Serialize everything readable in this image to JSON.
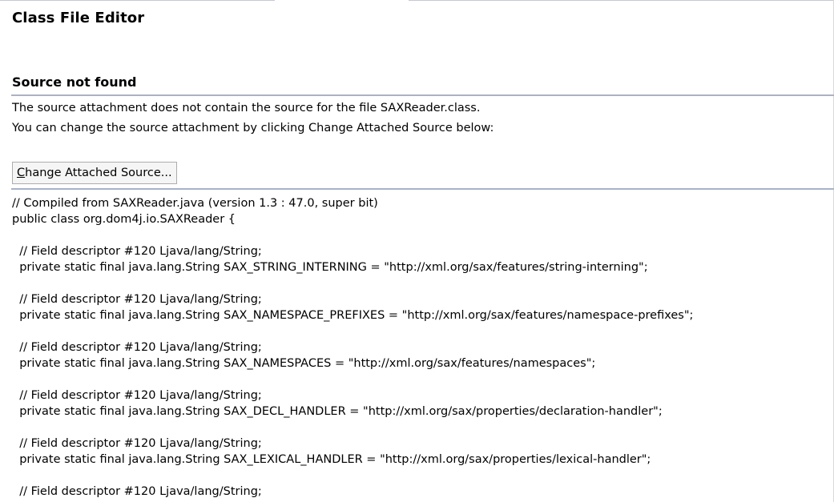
{
  "editor": {
    "title": "Class File Editor"
  },
  "source_not_found": {
    "heading": "Source not found",
    "message1": "The source attachment does not contain the source for the file SAXReader.class.",
    "message2": "You can change the source attachment by clicking Change Attached Source below:",
    "button": {
      "mnemonic": "C",
      "rest": "hange Attached Source..."
    }
  },
  "code_lines": [
    "// Compiled from SAXReader.java (version 1.3 : 47.0, super bit)",
    "public class org.dom4j.io.SAXReader {",
    "",
    "  // Field descriptor #120 Ljava/lang/String;",
    "  private static final java.lang.String SAX_STRING_INTERNING = \"http://xml.org/sax/features/string-interning\";",
    "",
    "  // Field descriptor #120 Ljava/lang/String;",
    "  private static final java.lang.String SAX_NAMESPACE_PREFIXES = \"http://xml.org/sax/features/namespace-prefixes\";",
    "",
    "  // Field descriptor #120 Ljava/lang/String;",
    "  private static final java.lang.String SAX_NAMESPACES = \"http://xml.org/sax/features/namespaces\";",
    "",
    "  // Field descriptor #120 Ljava/lang/String;",
    "  private static final java.lang.String SAX_DECL_HANDLER = \"http://xml.org/sax/properties/declaration-handler\";",
    "",
    "  // Field descriptor #120 Ljava/lang/String;",
    "  private static final java.lang.String SAX_LEXICAL_HANDLER = \"http://xml.org/sax/properties/lexical-handler\";",
    "",
    "  // Field descriptor #120 Ljava/lang/String;"
  ]
}
